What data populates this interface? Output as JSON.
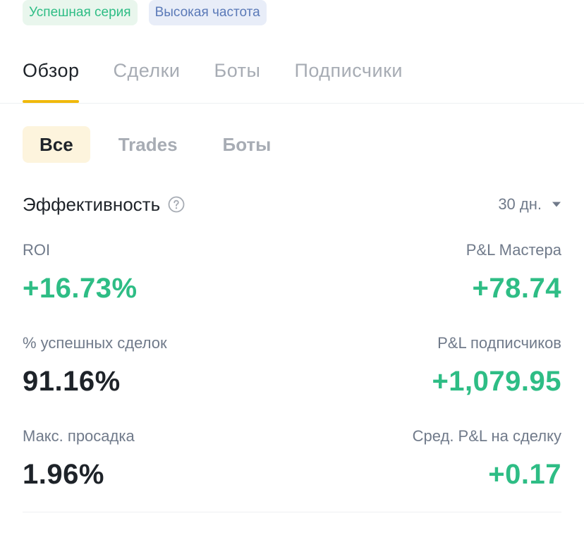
{
  "badges": {
    "success": "Успешная серия",
    "frequency": "Высокая частота"
  },
  "main_tabs": [
    {
      "label": "Обзор",
      "active": true
    },
    {
      "label": "Сделки",
      "active": false
    },
    {
      "label": "Боты",
      "active": false
    },
    {
      "label": "Подписчики",
      "active": false
    }
  ],
  "sub_tabs": [
    {
      "label": "Все",
      "active": true
    },
    {
      "label": "Trades",
      "active": false
    },
    {
      "label": "Боты",
      "active": false
    }
  ],
  "performance": {
    "title": "Эффективность",
    "help_icon": "question-circle-icon",
    "period": "30 дн.",
    "period_icon": "caret-down-icon"
  },
  "metrics": {
    "roi": {
      "label": "ROI",
      "value": "+16.73%"
    },
    "master_pnl": {
      "label": "P&L Мастера",
      "value": "+78.74"
    },
    "win_rate": {
      "label": "% успешных сделок",
      "value": "91.16%"
    },
    "followers_pnl": {
      "label": "P&L подписчиков",
      "value": "+1,079.95"
    },
    "max_drawdown": {
      "label": "Макс. просадка",
      "value": "1.96%"
    },
    "avg_pnl_per_trade": {
      "label": "Сред. P&L на сделку",
      "value": "+0.17"
    }
  },
  "colors": {
    "accent": "#f0b90b",
    "positive": "#2ebd85",
    "text_primary": "#1e2329",
    "text_secondary": "#707a8a",
    "tab_inactive": "#a7acb4"
  }
}
